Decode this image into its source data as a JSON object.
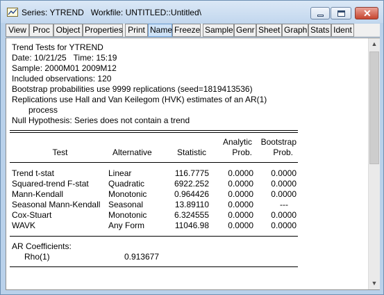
{
  "window": {
    "title": "Series: YTREND   Workfile: UNTITLED::Untitled\\"
  },
  "toolbar": {
    "buttons": [
      "View",
      "Proc",
      "Object",
      "Properties",
      "Print",
      "Name",
      "Freeze",
      "Sample",
      "Genr",
      "Sheet",
      "Graph",
      "Stats",
      "Ident"
    ]
  },
  "output": {
    "header_lines": [
      "Trend Tests for YTREND",
      "Date: 10/21/25   Time: 15:19",
      "Sample: 2000M01 2009M12",
      "Included observations: 120",
      "Bootstrap probabilities use 9999 replications (seed=1819413536)",
      "Replications use Hall and Van Keilegom (HVK) estimates of an AR(1)",
      "process",
      "Null Hypothesis: Series does not contain a trend"
    ],
    "table": {
      "col_headers_top": [
        "",
        "",
        "",
        "Analytic",
        "Bootstrap"
      ],
      "col_headers": [
        "Test",
        "Alternative",
        "Statistic",
        "Prob.",
        "Prob."
      ],
      "rows": [
        [
          "Trend t-stat",
          "Linear",
          "116.7775",
          "0.0000",
          "0.0000"
        ],
        [
          "Squared-trend F-stat",
          "Quadratic",
          "6922.252",
          "0.0000",
          "0.0000"
        ],
        [
          "Mann-Kendall",
          "Monotonic",
          "0.964426",
          "0.0000",
          "0.0000"
        ],
        [
          "Seasonal Mann-Kendall",
          "Seasonal",
          "13.89110",
          "0.0000",
          "---"
        ],
        [
          "Cox-Stuart",
          "Monotonic",
          "6.324555",
          "0.0000",
          "0.0000"
        ],
        [
          "WAVK",
          "Any Form",
          "11046.98",
          "0.0000",
          "0.0000"
        ]
      ]
    },
    "ar": {
      "label": "AR Coefficients:",
      "name": "Rho(1)",
      "value": "0.913677"
    }
  },
  "icons": {
    "title": "series-window-icon",
    "scroll_up": "scroll-up-arrow-icon",
    "scroll_down": "scroll-down-arrow-icon"
  }
}
